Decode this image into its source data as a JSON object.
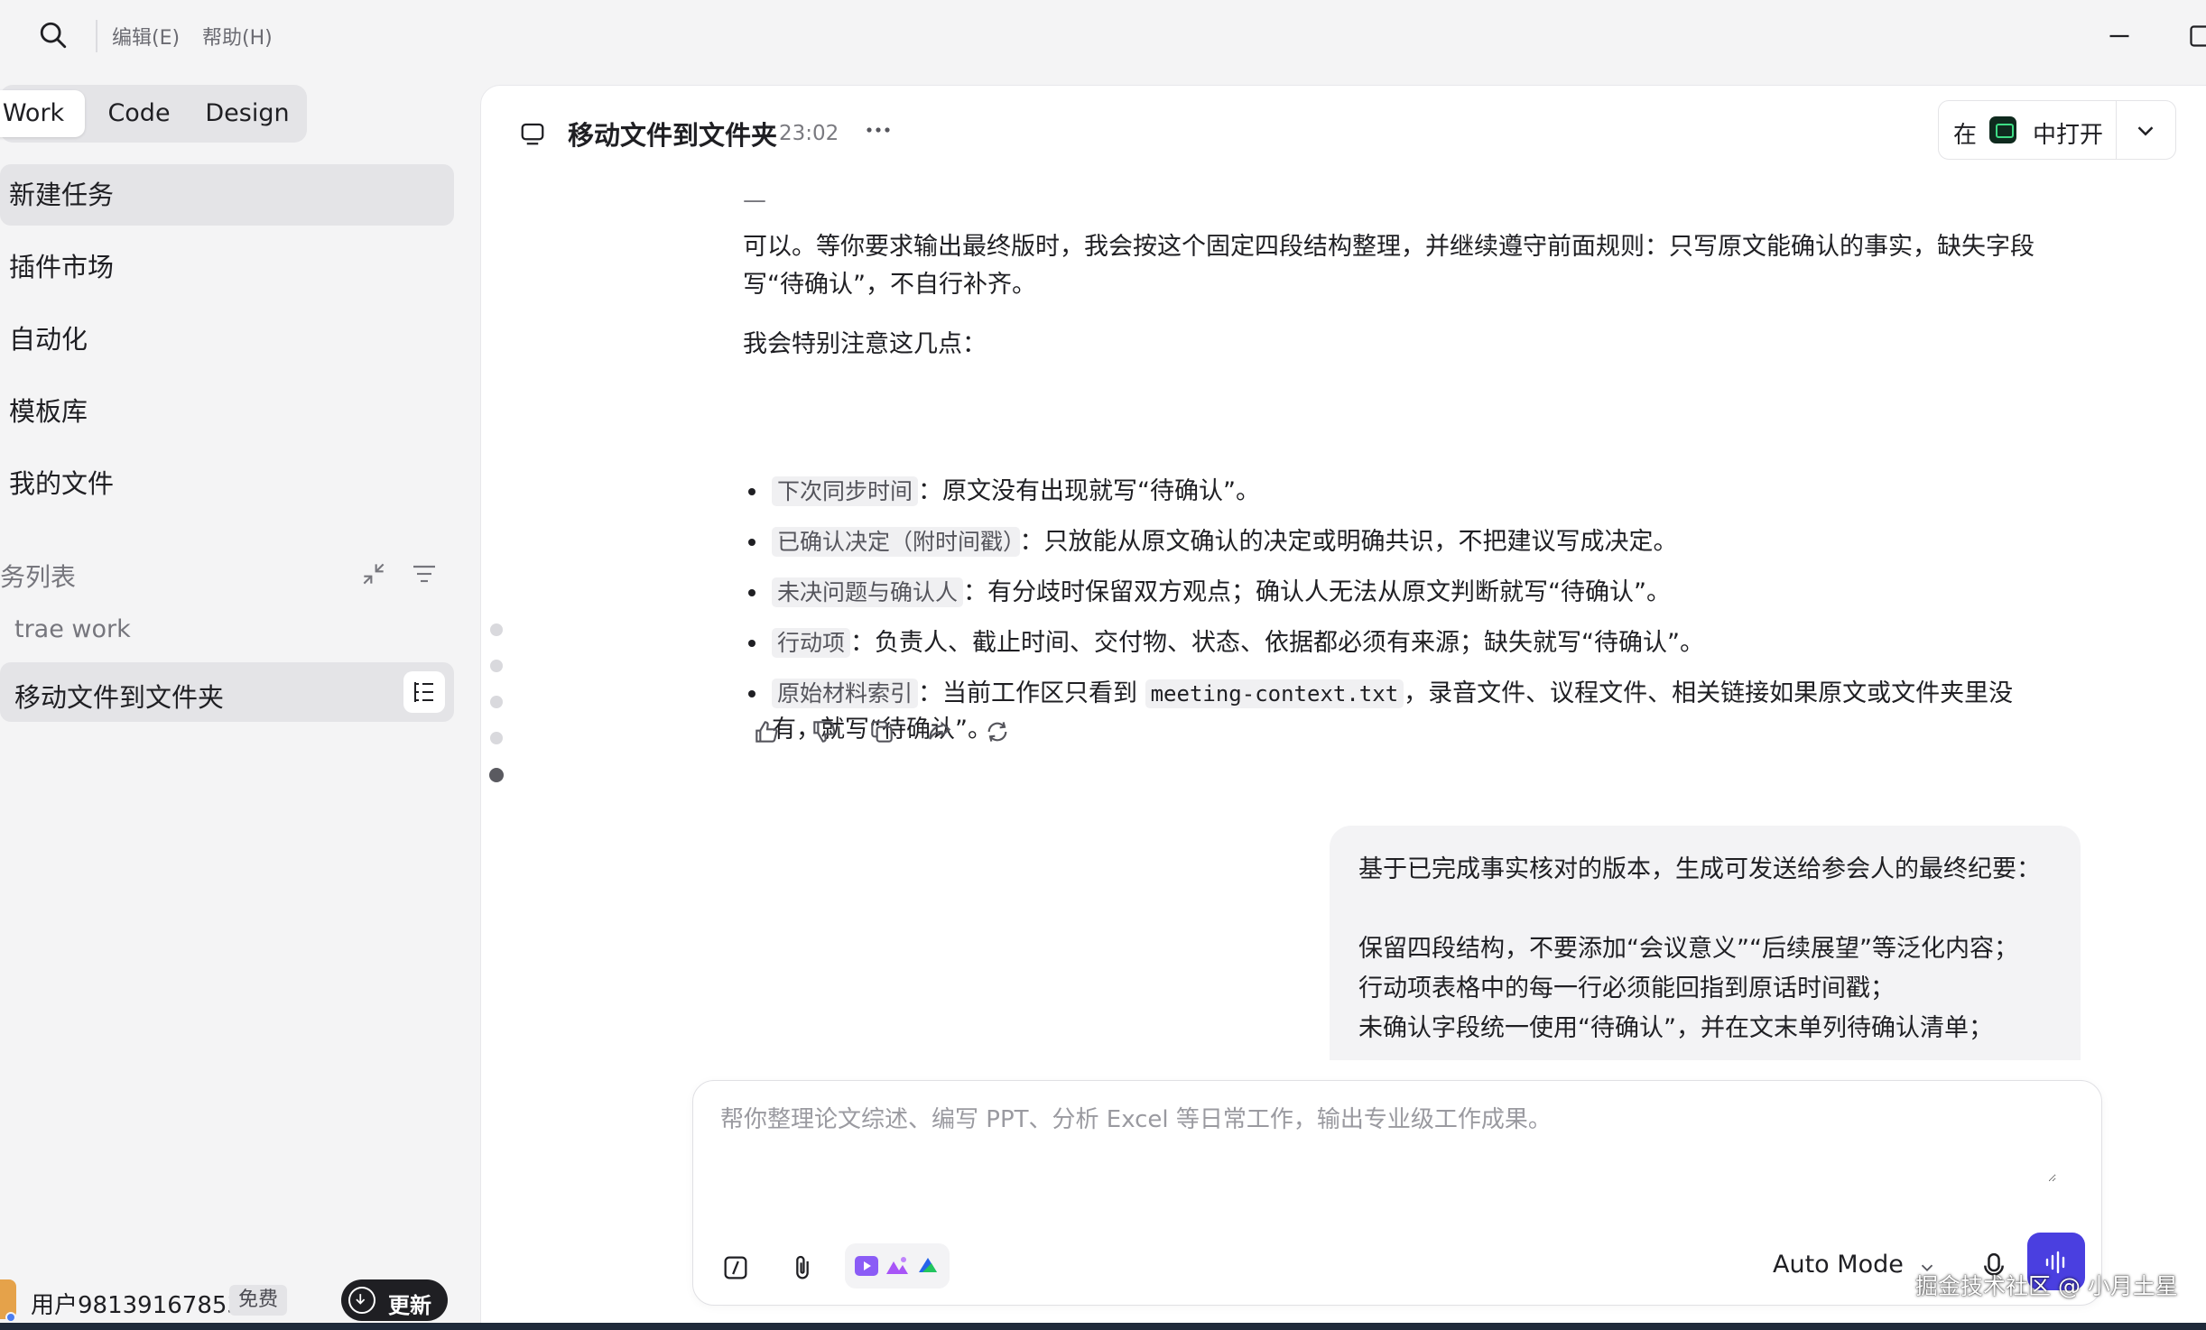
{
  "menu": {
    "edit": "编辑(E)",
    "help": "帮助(H)"
  },
  "modes": [
    {
      "label": "Work",
      "active": true
    },
    {
      "label": "Code",
      "active": false
    },
    {
      "label": "Design",
      "active": false
    }
  ],
  "nav": [
    {
      "label": "新建任务",
      "active": true
    },
    {
      "label": "插件市场",
      "active": false
    },
    {
      "label": "自动化",
      "active": false
    },
    {
      "label": "模板库",
      "active": false
    },
    {
      "label": "我的文件",
      "active": false
    }
  ],
  "task_list": {
    "header": "务列表",
    "group": "trae work",
    "items": [
      {
        "label": "移动文件到文件夹",
        "active": true
      }
    ]
  },
  "user": {
    "name": "用户98139167853",
    "plan": "免费",
    "update_label": "更新"
  },
  "chat": {
    "title": "移动文件到文件夹",
    "time": "23:02",
    "open_in": {
      "prefix": "在",
      "suffix": "中打开"
    },
    "answer": {
      "divider": "—",
      "para1": "可以。等你要求输出最终版时，我会按这个固定四段结构整理，并继续遵守前面规则：只写原文能确认的事实，缺失字段写“待确认”，不自行补齐。",
      "para2": "我会特别注意这几点：",
      "bullets": [
        {
          "tag": "下次同步时间",
          "text": "：原文没有出现就写“待确认”。"
        },
        {
          "tag": "已确认决定（附时间戳）",
          "text": "：只放能从原文确认的决定或明确共识，不把建议写成决定。"
        },
        {
          "tag": "未决问题与确认人",
          "text": "：有分歧时保留双方观点；确认人无法从原文判断就写“待确认”。"
        },
        {
          "tag": "行动项",
          "text": "：负责人、截止时间、交付物、状态、依据都必须有来源；缺失就写“待确认”。"
        },
        {
          "tag": "原始材料索引",
          "text_before": "：当前工作区只看到 ",
          "code": "meeting-context.txt",
          "text_after": "，录音文件、议程文件、相关链接如果原文或文件夹里没有，就写“待确认”。"
        }
      ]
    },
    "user_message": [
      "基于已完成事实核对的版本，生成可发送给参会人的最终纪要：",
      "保留四段结构，不要添加“会议意义”“后续展望”等泛化内容；",
      "行动项表格中的每一行必须能回指到原话时间戳；",
      "未确认字段统一使用“待确认”，并在文末单列待确认清单；"
    ]
  },
  "composer": {
    "placeholder": "帮你整理论文综述、编写 PPT、分析 Excel 等日常工作，输出专业级工作成果。",
    "mode": "Auto Mode"
  },
  "watermark": "掘金技术社区 @ 小月土星",
  "colors": {
    "accent": "#4a3fe0",
    "sidebar_bg": "#f4f4f5",
    "active_item": "#e4e4e7"
  }
}
